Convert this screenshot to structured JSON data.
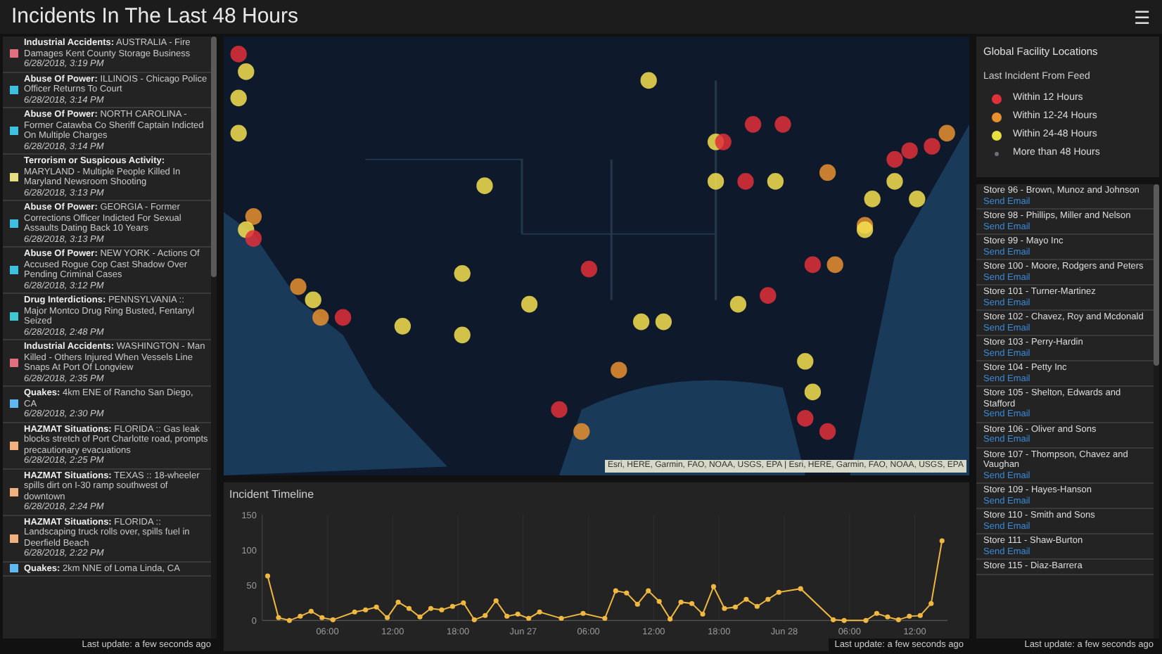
{
  "header": {
    "title": "Incidents In The Last 48 Hours",
    "menu_glyph": "☰"
  },
  "incidents": {
    "items": [
      {
        "category": "Industrial Accidents:",
        "text": "AUSTRALIA - Fire Damages Kent County Storage Business",
        "time": "6/28/2018, 3:19 PM",
        "color": "#e07080"
      },
      {
        "category": "Abuse Of Power:",
        "text": "ILLINOIS - Chicago Police Officer Returns To Court",
        "time": "6/28/2018, 3:14 PM",
        "color": "#3ec0e0"
      },
      {
        "category": "Abuse Of Power:",
        "text": "NORTH CAROLINA - Former Catawba Co Sheriff Captain Indicted On Multiple Charges",
        "time": "6/28/2018, 3:14 PM",
        "color": "#3ec0e0"
      },
      {
        "category": "Terrorism or Suspicous Activity:",
        "text": "MARYLAND - Multiple People Killed In Maryland Newsroom Shooting",
        "time": "6/28/2018, 3:13 PM",
        "color": "#e8dc80"
      },
      {
        "category": "Abuse Of Power:",
        "text": "GEORGIA - Former Corrections Officer Indicted For Sexual Assaults Dating Back 10 Years",
        "time": "6/28/2018, 3:13 PM",
        "color": "#3ec0e0"
      },
      {
        "category": "Abuse Of Power:",
        "text": "NEW YORK - Actions Of Accused Rogue Cop Cast Shadow Over Pending Criminal Cases",
        "time": "6/28/2018, 3:12 PM",
        "color": "#3ec0e0"
      },
      {
        "category": "Drug Interdictions:",
        "text": "PENNSYLVANIA :: Major Montco Drug Ring Busted, Fentanyl Seized",
        "time": "6/28/2018, 2:48 PM",
        "color": "#40c8d0"
      },
      {
        "category": "Industrial Accidents:",
        "text": "WASHINGTON - Man Killed - Others Injured When Vessels Line Snaps At Port Of Longview",
        "time": "6/28/2018, 2:35 PM",
        "color": "#e07080"
      },
      {
        "category": "Quakes:",
        "text": "4km ENE of Rancho San Diego, CA",
        "time": "6/28/2018, 2:30 PM",
        "color": "#60b8f0"
      },
      {
        "category": "HAZMAT Situations:",
        "text": "FLORIDA :: Gas leak blocks stretch of Port Charlotte road, prompts precautionary evacuations",
        "time": "6/28/2018, 2:25 PM",
        "color": "#f0b080"
      },
      {
        "category": "HAZMAT Situations:",
        "text": "TEXAS :: 18-wheeler spills dirt on I-30 ramp southwest of downtown",
        "time": "6/28/2018, 2:24 PM",
        "color": "#f0b080"
      },
      {
        "category": "HAZMAT Situations:",
        "text": "FLORIDA :: Landscaping truck rolls over, spills fuel in Deerfield Beach",
        "time": "6/28/2018, 2:22 PM",
        "color": "#f0b080"
      },
      {
        "category": "Quakes:",
        "text": "2km NNE of Loma Linda, CA",
        "color": "#60b8f0"
      }
    ],
    "status": "Last update: a few seconds ago"
  },
  "map": {
    "attribution": "Esri, HERE, Garmin, FAO, NOAA, USGS, EPA | Esri, HERE, Garmin, FAO, NOAA, USGS, EPA"
  },
  "timeline": {
    "title": "Incident Timeline",
    "status": "Last update: a few seconds ago",
    "chart_data": {
      "type": "line",
      "grid": true,
      "marker": true,
      "x": [
        "2018-06-26T00:30",
        "2018-06-26T01:30",
        "2018-06-26T02:30",
        "2018-06-26T03:30",
        "2018-06-26T04:30",
        "2018-06-26T05:30",
        "2018-06-26T06:30",
        "2018-06-26T08:30",
        "2018-06-26T09:30",
        "2018-06-26T10:30",
        "2018-06-26T11:30",
        "2018-06-26T12:30",
        "2018-06-26T13:30",
        "2018-06-26T14:30",
        "2018-06-26T15:30",
        "2018-06-26T16:30",
        "2018-06-26T17:30",
        "2018-06-26T18:30",
        "2018-06-26T19:30",
        "2018-06-26T20:30",
        "2018-06-26T21:30",
        "2018-06-26T22:30",
        "2018-06-26T23:30",
        "2018-06-27T00:30",
        "2018-06-27T01:30",
        "2018-06-27T03:30",
        "2018-06-27T05:30",
        "2018-06-27T07:30",
        "2018-06-27T08:30",
        "2018-06-27T09:30",
        "2018-06-27T10:30",
        "2018-06-27T11:30",
        "2018-06-27T12:30",
        "2018-06-27T13:30",
        "2018-06-27T14:30",
        "2018-06-27T15:30",
        "2018-06-27T16:30",
        "2018-06-27T17:30",
        "2018-06-27T18:30",
        "2018-06-27T19:30",
        "2018-06-27T20:30",
        "2018-06-27T21:30",
        "2018-06-27T22:30",
        "2018-06-27T23:30",
        "2018-06-28T01:30",
        "2018-06-28T04:30",
        "2018-06-28T05:30",
        "2018-06-28T07:30",
        "2018-06-28T08:30",
        "2018-06-28T09:30",
        "2018-06-28T10:30",
        "2018-06-28T11:30",
        "2018-06-28T12:30",
        "2018-06-28T13:30",
        "2018-06-28T14:30"
      ],
      "series": [
        {
          "color": "#f0b840",
          "values": [
            63,
            4,
            0,
            6,
            13,
            4,
            1,
            12,
            15,
            19,
            4,
            26,
            17,
            5,
            17,
            15,
            20,
            25,
            1,
            7,
            28,
            6,
            9,
            3,
            12,
            3,
            10,
            3,
            42,
            39,
            23,
            42,
            27,
            2,
            26,
            24,
            9,
            48,
            17,
            19,
            30,
            20,
            30,
            40,
            45,
            1,
            0,
            0,
            10,
            5,
            1,
            6,
            7,
            24,
            113
          ]
        }
      ],
      "xlim": [
        "2018-06-26T00:00",
        "2018-06-28T15:00"
      ],
      "ylim": [
        0,
        150
      ],
      "xticks": [
        {
          "value": "2018-06-26T06:00",
          "label": "06:00"
        },
        {
          "value": "2018-06-26T12:00",
          "label": "12:00"
        },
        {
          "value": "2018-06-26T18:00",
          "label": "18:00"
        },
        {
          "value": "2018-06-27T00:00",
          "label": "Jun 27"
        },
        {
          "value": "2018-06-27T06:00",
          "label": "06:00"
        },
        {
          "value": "2018-06-27T12:00",
          "label": "12:00"
        },
        {
          "value": "2018-06-27T18:00",
          "label": "18:00"
        },
        {
          "value": "2018-06-28T00:00",
          "label": "Jun 28"
        },
        {
          "value": "2018-06-28T06:00",
          "label": "06:00"
        },
        {
          "value": "2018-06-28T12:00",
          "label": "12:00"
        }
      ],
      "yticks": [
        0,
        50,
        100,
        150
      ]
    }
  },
  "legend": {
    "title": "Global Facility Locations",
    "subtitle": "Last Incident From Feed",
    "items": [
      {
        "label": "Within 12 Hours",
        "color": "#e0303a"
      },
      {
        "label": "Within 12-24 Hours",
        "color": "#e89030"
      },
      {
        "label": "Within 24-48 Hours",
        "color": "#e8e040"
      },
      {
        "label": "More than 48 Hours",
        "color": "#6a7078"
      }
    ]
  },
  "stores": {
    "items": [
      {
        "name": "Store 96 - Brown, Munoz and Johnson",
        "link": "Send Email"
      },
      {
        "name": "Store 98 - Phillips, Miller and Nelson",
        "link": "Send Email"
      },
      {
        "name": "Store 99 - Mayo Inc",
        "link": "Send Email"
      },
      {
        "name": "Store 100 - Moore, Rodgers and Peters",
        "link": "Send Email"
      },
      {
        "name": "Store 101 - Turner-Martinez",
        "link": "Send Email"
      },
      {
        "name": "Store 102 - Chavez, Roy and Mcdonald",
        "link": "Send Email"
      },
      {
        "name": "Store 103 - Perry-Hardin",
        "link": "Send Email"
      },
      {
        "name": "Store 104 - Petty Inc",
        "link": "Send Email"
      },
      {
        "name": "Store 105 - Shelton, Edwards and Stafford",
        "link": "Send Email"
      },
      {
        "name": "Store 106 - Oliver and Sons",
        "link": "Send Email"
      },
      {
        "name": "Store 107 - Thompson, Chavez and Vaughan",
        "link": "Send Email"
      },
      {
        "name": "Store 109 - Hayes-Hanson",
        "link": "Send Email"
      },
      {
        "name": "Store 110 - Smith and Sons",
        "link": "Send Email"
      },
      {
        "name": "Store 111 - Shaw-Burton",
        "link": "Send Email"
      },
      {
        "name": "Store 115 - Diaz-Barrera"
      }
    ],
    "status": "Last update: a few seconds ago"
  }
}
